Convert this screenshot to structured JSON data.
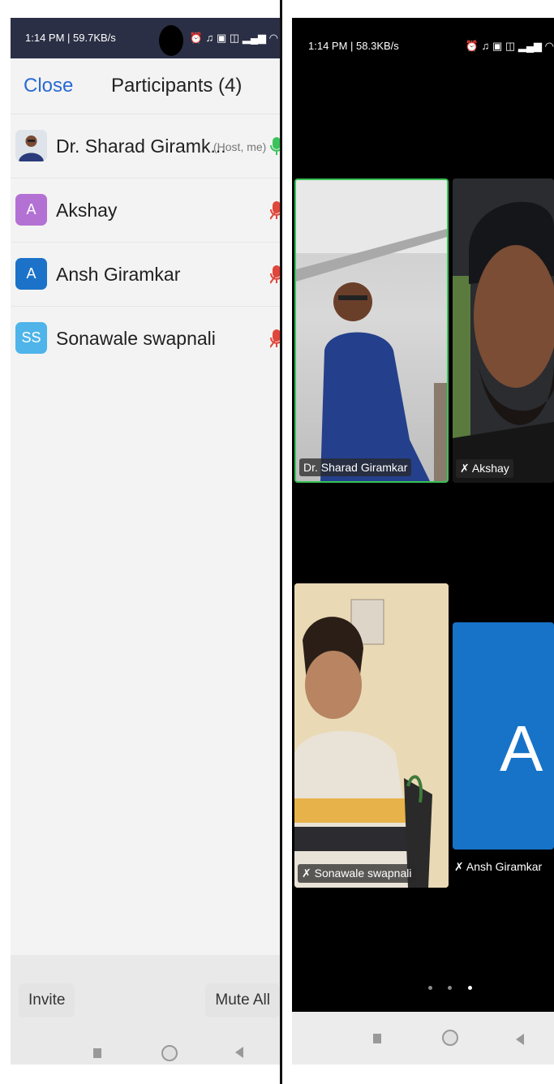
{
  "left": {
    "status": {
      "time": "1:14 PM | 59.7KB/s",
      "icons": "⏰ ♫ ▣ ◫ ▂▄▆ ◠"
    },
    "header": {
      "close_label": "Close",
      "title": "Participants (4)"
    },
    "participants": [
      {
        "name": "Dr. Sharad Giramk...",
        "role": "(Host, me)",
        "initials": "",
        "avatar_color": "#dfe4ea",
        "mic": "on"
      },
      {
        "name": "Akshay",
        "role": "",
        "initials": "A",
        "avatar_color": "#b371d4",
        "mic": "muted"
      },
      {
        "name": "Ansh Giramkar",
        "role": "",
        "initials": "A",
        "avatar_color": "#1c72c8",
        "mic": "muted"
      },
      {
        "name": "Sonawale swapnali",
        "role": "",
        "initials": "SS",
        "avatar_color": "#4eb4ea",
        "mic": "muted"
      }
    ],
    "footer": {
      "invite_label": "Invite",
      "mute_all_label": "Mute All"
    }
  },
  "right": {
    "status": {
      "time": "1:14 PM | 58.3KB/s",
      "icons": "⏰ ♫ ▣ ◫ ▂▄▆ ◠"
    },
    "tiles": [
      {
        "name": "Dr. Sharad Giramkar"
      },
      {
        "name": "Akshay"
      },
      {
        "name": "Sonawale swapnali"
      },
      {
        "name": "Ansh Giramkar",
        "initial": "A"
      }
    ]
  },
  "colors": {
    "accent": "#2a6ad3",
    "active_speaker": "#39c158",
    "mic_muted": "#e0463a",
    "mic_on": "#3bc25a"
  }
}
